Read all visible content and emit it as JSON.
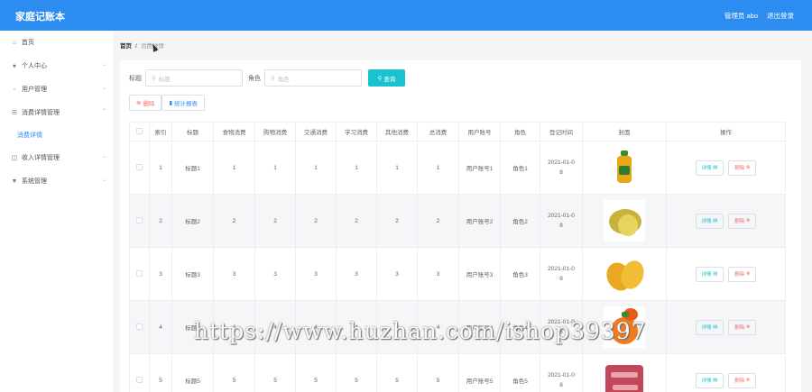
{
  "header": {
    "brand": "家庭记账本",
    "user_label": "管理员 abo",
    "logout_label": "退出登录"
  },
  "sidebar": {
    "items": [
      {
        "label": "首页",
        "icon": "home-icon",
        "glyph": "⌂",
        "chevron": ""
      },
      {
        "label": "个人中心",
        "icon": "user-icon",
        "glyph": "●",
        "chevron": "⌄"
      },
      {
        "label": "用户管理",
        "icon": "user-manage-icon",
        "glyph": "◦",
        "chevron": "⌄"
      },
      {
        "label": "消费详情管理",
        "icon": "list-icon",
        "glyph": "☰",
        "chevron": "⌃"
      },
      {
        "label": "收入详情管理",
        "icon": "income-icon",
        "glyph": "◫",
        "chevron": "⌄"
      },
      {
        "label": "系统管理",
        "icon": "system-icon",
        "glyph": "▼",
        "chevron": "⌄"
      }
    ],
    "active_sub": "消费详情"
  },
  "breadcrumb": {
    "home": "首页",
    "separator": "/",
    "current": "消费详情"
  },
  "search": {
    "title_label": "标题",
    "title_placeholder": "标题",
    "role_label": "角色",
    "role_placeholder": "角色",
    "query_label": "查询",
    "search_glyph": "⚲"
  },
  "actions": {
    "delete_label": "删除",
    "stats_label": "统计报表"
  },
  "table": {
    "headers": [
      "",
      "索引",
      "标题",
      "食物消费",
      "购物消费",
      "交通消费",
      "学习消费",
      "其他消费",
      "总消费",
      "用户账号",
      "角色",
      "登记时间",
      "封面",
      "操作"
    ],
    "rows": [
      {
        "index": "1",
        "title": "标题1",
        "food": "1",
        "shopping": "1",
        "traffic": "1",
        "study": "1",
        "other": "1",
        "total": "1",
        "account": "用户账号1",
        "role": "角色1",
        "date1": "2021-01-0",
        "date2": "8",
        "cover": "oil-bottle"
      },
      {
        "index": "2",
        "title": "标题2",
        "food": "2",
        "shopping": "2",
        "traffic": "2",
        "study": "2",
        "other": "2",
        "total": "2",
        "account": "用户账号2",
        "role": "角色2",
        "date1": "2021-01-0",
        "date2": "8",
        "cover": "jackfruit"
      },
      {
        "index": "3",
        "title": "标题3",
        "food": "3",
        "shopping": "3",
        "traffic": "3",
        "study": "3",
        "other": "3",
        "total": "3",
        "account": "用户账号3",
        "role": "角色3",
        "date1": "2021-01-0",
        "date2": "8",
        "cover": "mango"
      },
      {
        "index": "4",
        "title": "标题4",
        "food": "4",
        "shopping": "4",
        "traffic": "4",
        "study": "4",
        "other": "4",
        "total": "4",
        "account": "用户账号4",
        "role": "角色4",
        "date1": "2021-01-0",
        "date2": "8",
        "cover": "apricot"
      },
      {
        "index": "5",
        "title": "标题5",
        "food": "5",
        "shopping": "5",
        "traffic": "5",
        "study": "5",
        "other": "5",
        "total": "5",
        "account": "用户账号5",
        "role": "角色5",
        "date1": "2021-01-0",
        "date2": "8",
        "cover": "meat"
      }
    ],
    "detail_label": "详情",
    "detail_glyph": "▤",
    "delete_label": "删除",
    "delete_glyph": "⊗"
  },
  "watermark": "https://www.huzhan.com/ishop39397",
  "colors": {
    "header": "#2d8cf0",
    "query_button": "#18c2cf",
    "delete": "#f56c6c"
  }
}
